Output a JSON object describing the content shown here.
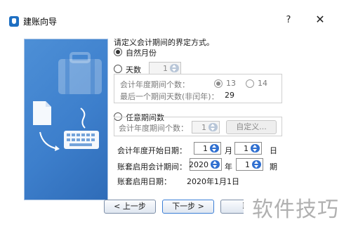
{
  "window": {
    "title": "建账向导",
    "help": "?",
    "close": "X"
  },
  "prompt": "请定义会计期间的界定方式。",
  "natural_month": {
    "label": "自然月份",
    "selected": true
  },
  "days": {
    "label": "天数",
    "value": "1",
    "group_count_label": "会计年度期间个数：",
    "option_13": "13",
    "option_14": "14",
    "option_13_selected": true,
    "last_period_label": "最后一个期间天数(非闰年)：",
    "last_period_value": "29"
  },
  "arbitrary": {
    "label": "任意期间数",
    "count_label": "会计年度期间个数：",
    "count_value": "1",
    "define_button": "自定义..."
  },
  "fiscal_start": {
    "label": "会计年度开始日期：",
    "month": "1",
    "month_unit": "月",
    "day": "1",
    "day_unit": "日"
  },
  "enable_period": {
    "label": "账套启用会计期间：",
    "year": "2020",
    "year_unit": "年",
    "period": "1",
    "period_unit": "期"
  },
  "enable_date": {
    "label": "账套启用日期：",
    "value": "2020年1月1日"
  },
  "buttons": {
    "prev": "< 上一步",
    "next": "下一步 >",
    "third": "取"
  },
  "watermark": "软件技巧",
  "colors": {
    "accent": "#2f6fd0",
    "panel": "#3d7fcc"
  }
}
